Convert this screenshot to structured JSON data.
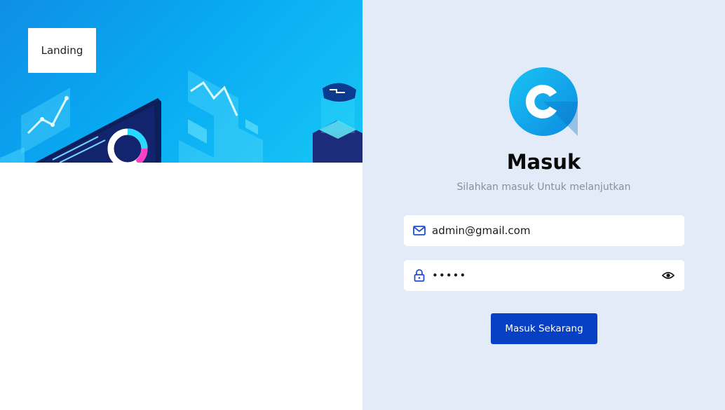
{
  "landing": {
    "label": "Landing"
  },
  "login": {
    "title": "Masuk",
    "subtitle": "Silahkan masuk Untuk melanjutkan",
    "email": {
      "value": "admin@gmail.com",
      "icon": "mail-icon"
    },
    "password": {
      "value": "admin",
      "icon": "lock-icon",
      "toggle_icon": "eye-icon"
    },
    "submit_label": "Masuk Sekarang"
  },
  "colors": {
    "accent": "#0740c4",
    "panel_bg": "#e4ebf8",
    "hero_blue": "#08a9f2"
  }
}
